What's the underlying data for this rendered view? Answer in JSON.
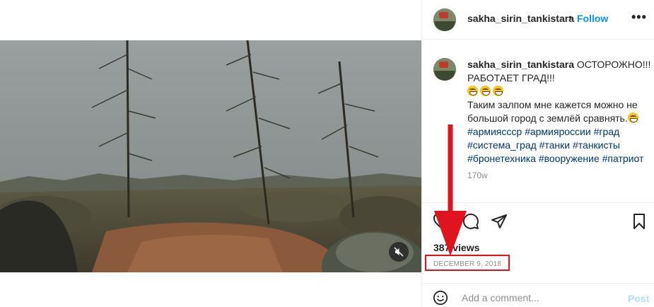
{
  "post": {
    "username": "sakha_sirin_tankistara",
    "header_dot": "•",
    "follow_label": "Follow",
    "more_label": "•••"
  },
  "caption": {
    "username": "sakha_sirin_tankistara",
    "line1": "ОСТОРОЖНО!!! РАБОТАЕТ ГРАД!!!",
    "line2": "Таким залпом мне кажется можно не большой город с землёй сравнять.",
    "hashtags": [
      "#армияссср",
      "#армияроссии",
      "#град",
      "#система_град",
      "#танки",
      "#танкисты",
      "#бронетехника",
      "#вооружение",
      "#патриот"
    ],
    "time": "170w"
  },
  "media": {
    "type": "video",
    "muted": true,
    "mute_icon": "speaker-muted-icon"
  },
  "actions": {
    "icons": [
      "heart-icon",
      "comment-icon",
      "share-icon",
      "bookmark-icon"
    ]
  },
  "stats": {
    "views": "387 views",
    "date": "DECEMBER 9, 2018"
  },
  "comment_box": {
    "placeholder": "Add a comment...",
    "post_label": "Post"
  },
  "colors": {
    "follow_blue": "#0095f6",
    "hashtag": "#00376b",
    "annotation_red": "#e0141e",
    "post_disabled": "#b2dffc"
  }
}
